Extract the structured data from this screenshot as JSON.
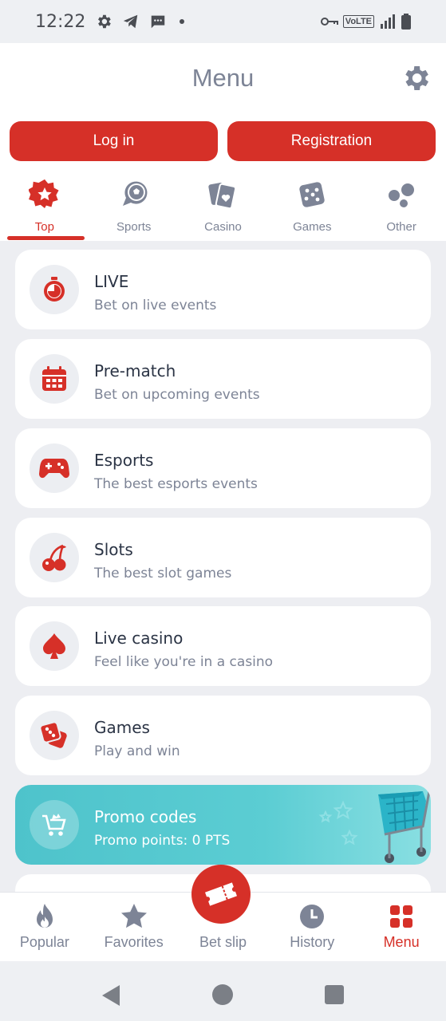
{
  "status_bar": {
    "time": "12:22",
    "left_icons": [
      "gear-icon",
      "telegram-icon",
      "message-icon",
      "dot-icon"
    ],
    "right_icons": [
      "key-icon",
      "volte-icon",
      "signal-icon",
      "battery-icon"
    ],
    "volte": "VoLTE"
  },
  "header": {
    "title": "Menu",
    "settings_icon": "gear-icon",
    "login_label": "Log in",
    "register_label": "Registration"
  },
  "tabs": [
    {
      "label": "Top",
      "icon": "star-badge-icon",
      "active": true
    },
    {
      "label": "Sports",
      "icon": "ball-icon",
      "active": false
    },
    {
      "label": "Casino",
      "icon": "cards-icon",
      "active": false
    },
    {
      "label": "Games",
      "icon": "dice-icon",
      "active": false
    },
    {
      "label": "Other",
      "icon": "circles-icon",
      "active": false
    }
  ],
  "menu_items": [
    {
      "title": "LIVE",
      "subtitle": "Bet on live events",
      "icon": "stopwatch-icon"
    },
    {
      "title": "Pre-match",
      "subtitle": "Bet on upcoming events",
      "icon": "calendar-icon"
    },
    {
      "title": "Esports",
      "subtitle": "The best esports events",
      "icon": "gamepad-icon"
    },
    {
      "title": "Slots",
      "subtitle": "The best slot games",
      "icon": "cherries-icon"
    },
    {
      "title": "Live casino",
      "subtitle": "Feel like you're in a casino",
      "icon": "spade-icon"
    },
    {
      "title": "Games",
      "subtitle": "Play and win",
      "icon": "dice-icon"
    },
    {
      "title": "Promo codes",
      "subtitle": "Promo points: 0 PTS",
      "icon": "cart-icon"
    }
  ],
  "bottom_nav": [
    {
      "label": "Popular",
      "icon": "flame-icon",
      "active": false
    },
    {
      "label": "Favorites",
      "icon": "star-icon",
      "active": false
    },
    {
      "label": "Bet slip",
      "icon": "ticket-icon",
      "active": false
    },
    {
      "label": "History",
      "icon": "clock-icon",
      "active": false
    },
    {
      "label": "Menu",
      "icon": "grid-icon",
      "active": true
    }
  ],
  "colors": {
    "accent": "#d63028",
    "text_muted": "#7d8496",
    "text_dark": "#2b3445",
    "promo": "#4ec3cb",
    "background": "#edeef2"
  }
}
